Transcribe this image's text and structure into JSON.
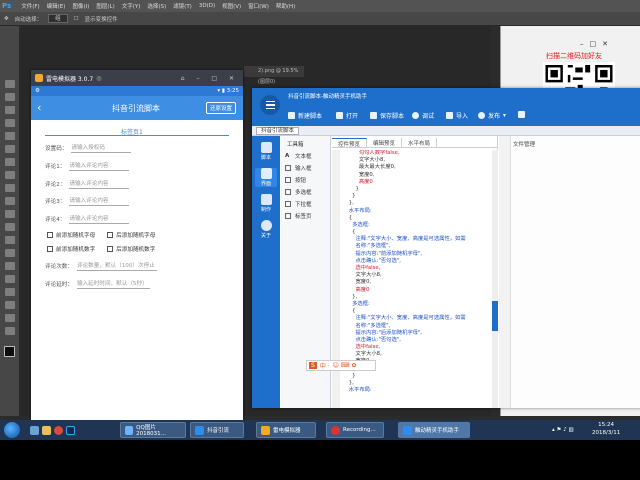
{
  "photoshop": {
    "logo": "Ps",
    "menu": [
      "文件(F)",
      "编辑(E)",
      "图像(I)",
      "图层(L)",
      "文字(Y)",
      "选择(S)",
      "滤镜(T)",
      "3D(D)",
      "视图(V)",
      "窗口(W)",
      "帮助(H)"
    ],
    "options": {
      "auto_select": "自动选择：",
      "value": "组",
      "transform": "显示变换控件"
    },
    "doc_tab": "2).png @ 19.5%(图层0)",
    "qr_title": "扫描二维码加好友"
  },
  "emulator": {
    "title": "雷电模拟器 3.0.7",
    "status_time": "3:25",
    "app_title": "抖音引流脚本",
    "reset_button": "还原设置",
    "tab": "标签页1",
    "fields": [
      {
        "label": "设置码：",
        "placeholder": "请输入授权码"
      },
      {
        "label": "评论1：",
        "placeholder": "请输入评论内容"
      },
      {
        "label": "评论2：",
        "placeholder": "请输入评论内容"
      },
      {
        "label": "评论3：",
        "placeholder": "请输入评论内容"
      },
      {
        "label": "评论4：",
        "placeholder": "请输入评论内容"
      }
    ],
    "checks_row1": [
      "前添加随机字母",
      "后添加随机字母"
    ],
    "checks_row2": [
      "前添加随机数字",
      "后添加随机数字"
    ],
    "count": {
      "label": "评论次数：",
      "placeholder": "评论数量，默认（100）次停止"
    },
    "delay": {
      "label": "评论延时：",
      "placeholder": "输入延时时间，默认（5秒）"
    }
  },
  "editor": {
    "title": "抖音引流脚本-触动精灵手机助手",
    "toolbar": [
      "新建脚本",
      "打开",
      "保存脚本",
      "调试",
      "导入",
      "发布",
      "",
      "联系客服"
    ],
    "file_tab": "抖音引流脚本",
    "side": [
      "脚本",
      "界面",
      "制作",
      "关于"
    ],
    "toolbox_title": "工具箱",
    "toolbox": [
      "文本框",
      "输入框",
      "按钮",
      "多选框",
      "下拉框",
      "标签页"
    ],
    "code_tabs": [
      "控件预览",
      "编辑预览",
      "水平布局"
    ],
    "code_lines": [
      "          勾勾人数字false,",
      "          文字大小8,",
      "          最大最大长度0,",
      "          宽度0,",
      "          高度0",
      "        }",
      "      }",
      "    },",
      "    水平布局:",
      "    {",
      "      多选框:",
      "      {",
      "        注释:\"文字大小、宽度、高度是可选属性，如需",
      "        名称:\"多选框\",",
      "        提示内容:\"前添加随机字母\",",
      "        点击确认:\"否勾选\",",
      "        选中false,",
      "        文字大小8,",
      "        宽度0,",
      "        高度0",
      "      },",
      "      多选框:",
      "      {",
      "        注释:\"文字大小、宽度、高度是可选属性，如需",
      "        名称:\"多选框\",",
      "        提示内容:\"后添加随机字母\",",
      "        点击确认:\"否勾选\",",
      "        选中false,",
      "        文字大小8,",
      "        宽度0,",
      "        高度0",
      "      }",
      "    },",
      "    水平布局:"
    ],
    "right_tab": "文件管理",
    "ime": "中 ·"
  },
  "taskbar": {
    "items": [
      "QQ图片2018031...",
      "抖音引流",
      "雷电模拟器",
      "Recording...",
      "触动精灵手机助手"
    ],
    "time": "15:24",
    "date": "2018/3/11"
  }
}
